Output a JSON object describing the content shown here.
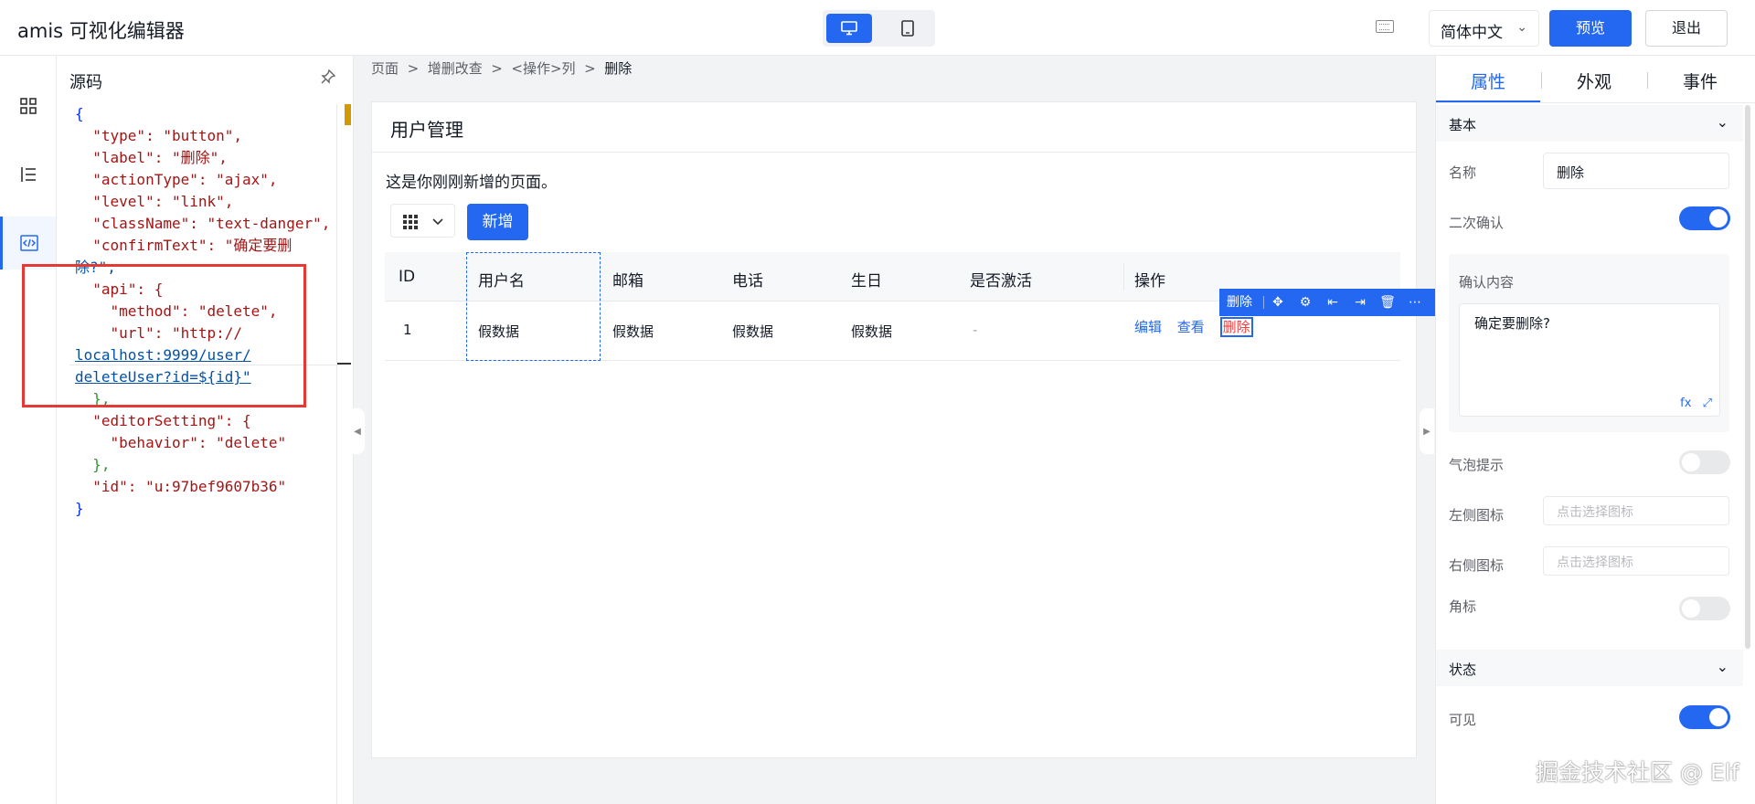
{
  "header": {
    "app_title": "amis 可视化编辑器",
    "device_modes": [
      {
        "name": "desktop",
        "active": true
      },
      {
        "name": "tablet",
        "active": false
      }
    ],
    "language": "简体中文",
    "preview_label": "预览",
    "exit_label": "退出"
  },
  "left_nav": {
    "items": [
      {
        "icon": "grid-icon",
        "active": false
      },
      {
        "icon": "outline-icon",
        "active": false
      },
      {
        "icon": "code-icon",
        "active": true
      }
    ]
  },
  "code_panel": {
    "title": "源码",
    "json_lines": [
      "{",
      "  \"type\": \"button\",",
      "  \"label\": \"删除\",",
      "  \"actionType\": \"ajax\",",
      "  \"level\": \"link\",",
      "  \"className\": \"text-danger\",",
      "  \"confirmText\": \"确定要删",
      "除?\",",
      "  \"api\": {",
      "    \"method\": \"delete\",",
      "    \"url\": \"http://",
      "localhost:9999/user/",
      "deleteUser?id=${id}\"",
      "  },",
      "  \"editorSetting\": {",
      "    \"behavior\": \"delete\"",
      "  },",
      "  \"id\": \"u:97bef9607b36\"",
      "}"
    ]
  },
  "breadcrumb": {
    "items": [
      "页面",
      "增删改查",
      "<操作>列",
      "删除"
    ],
    "separator": ">"
  },
  "page": {
    "title": "用户管理",
    "description": "这是你刚刚新增的页面。",
    "add_button": "新增",
    "table": {
      "columns": [
        "ID",
        "用户名",
        "邮箱",
        "电话",
        "生日",
        "是否激活",
        "操作"
      ],
      "rows": [
        {
          "id": "1",
          "username": "假数据",
          "email": "假数据",
          "phone": "假数据",
          "birthday": "假数据",
          "active": "-",
          "actions": [
            "编辑",
            "查看",
            "删除"
          ]
        }
      ]
    },
    "selection_toolbar": {
      "label": "删除",
      "icons": [
        "move-icon",
        "bug-icon",
        "insert-before-icon",
        "insert-after-icon",
        "delete-icon",
        "more-icon"
      ]
    }
  },
  "right_panel": {
    "tabs": [
      {
        "label": "属性",
        "active": true
      },
      {
        "label": "外观",
        "active": false
      },
      {
        "label": "事件",
        "active": false
      }
    ],
    "sections": {
      "basic": "基本",
      "state": "状态"
    },
    "fields": {
      "name_label": "名称",
      "name_value": "删除",
      "confirm_label": "二次确认",
      "confirm_on": true,
      "confirm_content_label": "确认内容",
      "confirm_content_value": "确定要删除?",
      "confirm_fx": "fx",
      "tooltip_label": "气泡提示",
      "tooltip_on": false,
      "left_icon_label": "左侧图标",
      "left_icon_placeholder": "点击选择图标",
      "right_icon_label": "右侧图标",
      "right_icon_placeholder": "点击选择图标",
      "badge_label": "角标",
      "badge_on": false,
      "visible_label": "可见",
      "visible_on": true
    }
  },
  "watermark": "掘金技术社区 @ Elf",
  "colors": {
    "primary": "#2468f2",
    "danger": "#f23d3d",
    "highlight_box": "#e53935"
  }
}
